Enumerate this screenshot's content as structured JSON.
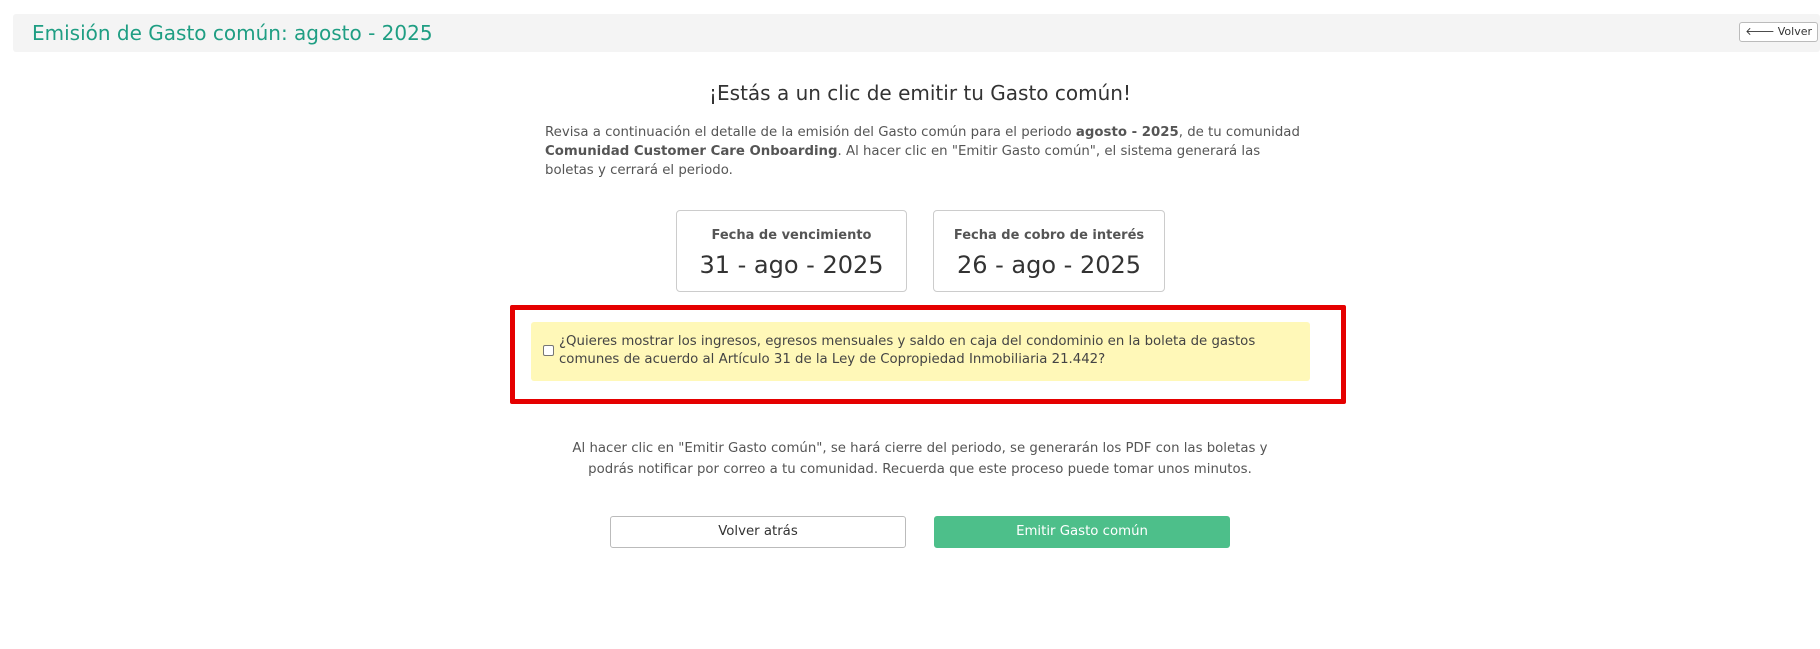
{
  "header": {
    "title": "Emisión de Gasto común: agosto - 2025",
    "back_button": {
      "arrow": "🡐",
      "label": "Volver"
    }
  },
  "main": {
    "headline": "¡Estás a un clic de emitir tu Gasto común!",
    "intro": {
      "part1": "Revisa a continuación el detalle de la emisión del Gasto común para el periodo ",
      "period": "agosto - 2025",
      "part2": ", de tu comunidad ",
      "community": "Comunidad Customer Care Onboarding",
      "part3": ". Al hacer clic en \"Emitir Gasto común\", el sistema generará las boletas y cerrará el periodo."
    },
    "due_date": {
      "label": "Fecha de vencimiento",
      "value": "31 - ago - 2025"
    },
    "interest_date": {
      "label": "Fecha de cobro de interés",
      "value": "26 - ago - 2025"
    },
    "notice": {
      "checked": false,
      "text": "¿Quieres mostrar los ingresos, egresos mensuales y saldo en caja del condominio en la boleta de gastos comunes de acuerdo al Artículo 31 de la Ley de Copropiedad Inmobiliaria 21.442?"
    },
    "footer_note": "Al hacer clic en \"Emitir Gasto común\", se hará cierre del periodo, se generarán los PDF con las boletas y podrás notificar por correo a tu comunidad. Recuerda que este proceso puede tomar unos minutos.",
    "back_label": "Volver atrás",
    "emit_label": "Emitir Gasto común"
  },
  "colors": {
    "title": "#1f9e83",
    "primary_button": "#4dbf8a",
    "notice_bg": "#fff8b8",
    "highlight": "#e50000"
  },
  "icons": {
    "back": "arrow-left-icon"
  }
}
